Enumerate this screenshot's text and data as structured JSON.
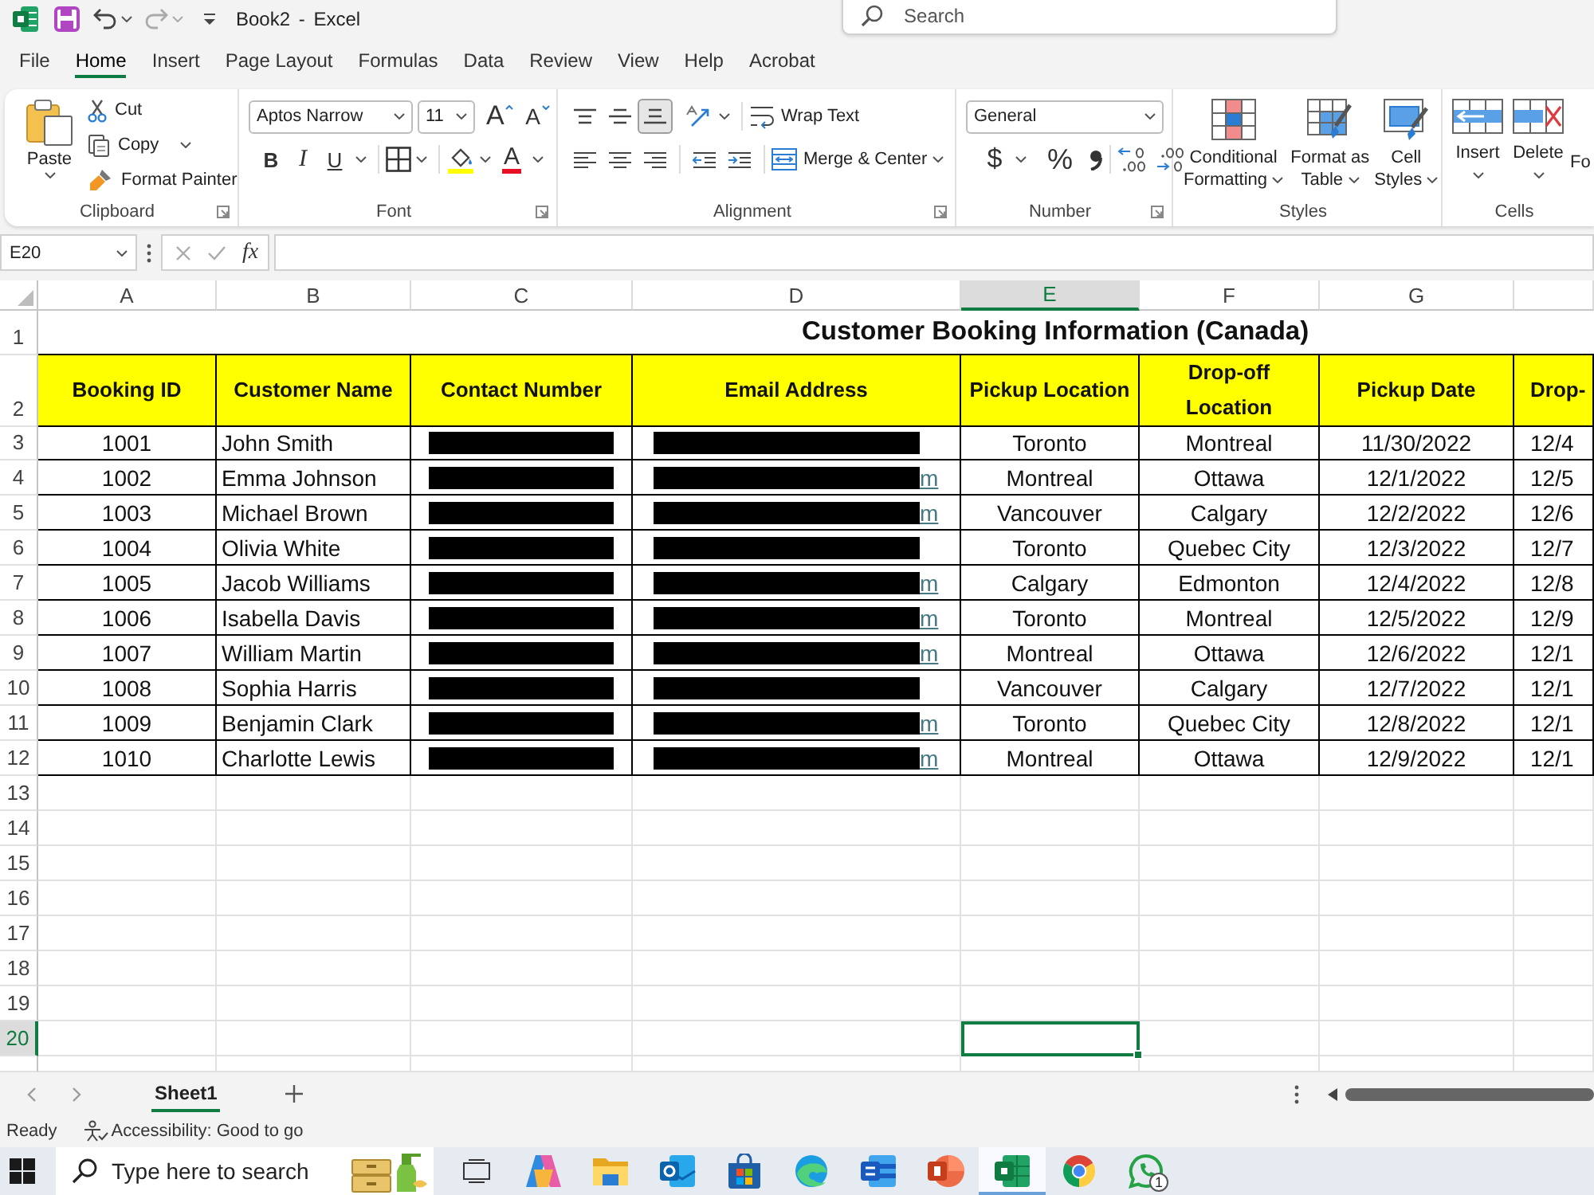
{
  "title_bar": {
    "title": "Book2 - Excel",
    "search": {
      "placeholder": "Search"
    }
  },
  "menu_tabs": [
    {
      "label": "File",
      "selected": false
    },
    {
      "label": "Home",
      "selected": true
    },
    {
      "label": "Insert",
      "selected": false
    },
    {
      "label": "Page Layout",
      "selected": false
    },
    {
      "label": "Formulas",
      "selected": false
    },
    {
      "label": "Data",
      "selected": false
    },
    {
      "label": "Review",
      "selected": false
    },
    {
      "label": "View",
      "selected": false
    },
    {
      "label": "Help",
      "selected": false
    },
    {
      "label": "Acrobat",
      "selected": false
    }
  ],
  "ribbon": [
    {
      "kind": "clipboard",
      "label": "Clipboard",
      "buttons": [
        "Paste",
        "Cut",
        "Copy",
        "Format Painter"
      ]
    },
    {
      "kind": "font",
      "label": "Font",
      "font_name": "Aptos Narrow",
      "font_size": "11",
      "buttons": [
        "A",
        "A",
        "B",
        "I",
        "U",
        "A"
      ]
    },
    {
      "kind": "alignment",
      "label": "Alignment",
      "vertical_align": [
        {
          "selected": false
        },
        {
          "selected": false
        },
        {
          "selected": true
        }
      ],
      "buttons": [
        "Wrap Text",
        "Merge & Center"
      ]
    },
    {
      "kind": "number",
      "label": "Number",
      "format": "General",
      "buttons": [
        "$",
        "%"
      ]
    },
    {
      "kind": "styles",
      "label": "Styles",
      "buttons": [
        "Conditional Formatting",
        "Format as Table",
        "Cell Styles"
      ]
    },
    {
      "kind": "cells",
      "label": "Cells",
      "buttons": [
        "Insert",
        "Delete",
        "Fo"
      ]
    }
  ],
  "formula_bar": {
    "name_box": "E20",
    "function_label": "fx"
  },
  "sheet": {
    "columns": [
      {
        "label": "A",
        "selected": false
      },
      {
        "label": "B",
        "selected": false
      },
      {
        "label": "C",
        "selected": false
      },
      {
        "label": "D",
        "selected": false
      },
      {
        "label": "E",
        "selected": true
      },
      {
        "label": "F",
        "selected": false
      },
      {
        "label": "G",
        "selected": false
      }
    ],
    "rows": [
      {
        "number": "1",
        "selected": false,
        "kind": "title",
        "text": "Customer Booking Information (Canada)"
      },
      {
        "number": "2",
        "selected": false,
        "kind": "header",
        "cells": [
          "Booking ID",
          "Customer Name",
          "Contact Number",
          "Email Address",
          "Pickup Location",
          "Drop-off Location",
          "Pickup Date",
          "Drop-"
        ]
      },
      {
        "number": "3",
        "selected": false,
        "kind": "data",
        "cells": [
          "1001",
          "John Smith",
          {
            "redacted": true
          },
          {
            "redacted": true
          },
          "Toronto",
          "Montreal",
          "11/30/2022",
          "12/4"
        ]
      },
      {
        "number": "4",
        "selected": false,
        "kind": "data",
        "cells": [
          "1002",
          "Emma Johnson",
          {
            "redacted": true
          },
          {
            "redacted": true,
            "tail": "m"
          },
          "Montreal",
          "Ottawa",
          "12/1/2022",
          "12/5"
        ]
      },
      {
        "number": "5",
        "selected": false,
        "kind": "data",
        "cells": [
          "1003",
          "Michael Brown",
          {
            "redacted": true
          },
          {
            "redacted": true,
            "tail": "m"
          },
          "Vancouver",
          "Calgary",
          "12/2/2022",
          "12/6"
        ]
      },
      {
        "number": "6",
        "selected": false,
        "kind": "data",
        "cells": [
          "1004",
          "Olivia White",
          {
            "redacted": true
          },
          {
            "redacted": true
          },
          "Toronto",
          "Quebec City",
          "12/3/2022",
          "12/7"
        ]
      },
      {
        "number": "7",
        "selected": false,
        "kind": "data",
        "cells": [
          "1005",
          "Jacob Williams",
          {
            "redacted": true
          },
          {
            "redacted": true,
            "tail": "m"
          },
          "Calgary",
          "Edmonton",
          "12/4/2022",
          "12/8"
        ]
      },
      {
        "number": "8",
        "selected": false,
        "kind": "data",
        "cells": [
          "1006",
          "Isabella Davis",
          {
            "redacted": true
          },
          {
            "redacted": true,
            "tail": "m"
          },
          "Toronto",
          "Montreal",
          "12/5/2022",
          "12/9"
        ]
      },
      {
        "number": "9",
        "selected": false,
        "kind": "data",
        "cells": [
          "1007",
          "William Martin",
          {
            "redacted": true
          },
          {
            "redacted": true,
            "tail": "m"
          },
          "Montreal",
          "Ottawa",
          "12/6/2022",
          "12/1"
        ]
      },
      {
        "number": "10",
        "selected": false,
        "kind": "data",
        "cells": [
          "1008",
          "Sophia Harris",
          {
            "redacted": true
          },
          {
            "redacted": true
          },
          "Vancouver",
          "Calgary",
          "12/7/2022",
          "12/1"
        ]
      },
      {
        "number": "11",
        "selected": false,
        "kind": "data",
        "cells": [
          "1009",
          "Benjamin Clark",
          {
            "redacted": true
          },
          {
            "redacted": true,
            "tail": "m"
          },
          "Toronto",
          "Quebec City",
          "12/8/2022",
          "12/1"
        ]
      },
      {
        "number": "12",
        "selected": false,
        "kind": "data",
        "cells": [
          "1010",
          "Charlotte Lewis",
          {
            "redacted": true
          },
          {
            "redacted": true,
            "tail": "m"
          },
          "Montreal",
          "Ottawa",
          "12/9/2022",
          "12/1"
        ]
      },
      {
        "number": "13",
        "selected": false,
        "kind": "empty"
      },
      {
        "number": "14",
        "selected": false,
        "kind": "empty"
      },
      {
        "number": "15",
        "selected": false,
        "kind": "empty"
      },
      {
        "number": "16",
        "selected": false,
        "kind": "empty"
      },
      {
        "number": "17",
        "selected": false,
        "kind": "empty"
      },
      {
        "number": "18",
        "selected": false,
        "kind": "empty"
      },
      {
        "number": "19",
        "selected": false,
        "kind": "empty"
      },
      {
        "number": "20",
        "selected": true,
        "kind": "empty"
      }
    ]
  },
  "sheet_tabs": [
    {
      "label": "Sheet1",
      "selected": true
    }
  ],
  "status_bar": {
    "status": "Ready",
    "accessibility": "Accessibility: Good to go"
  },
  "taskbar": {
    "search": {
      "placeholder": "Type here to search"
    },
    "apps": [
      {
        "selected": false
      },
      {
        "selected": false
      },
      {
        "selected": false
      },
      {
        "selected": false
      },
      {
        "selected": false
      },
      {
        "selected": false
      },
      {
        "selected": false
      },
      {
        "selected": false
      },
      {
        "selected": true
      },
      {
        "selected": false
      },
      {
        "selected": false,
        "badge": "1"
      }
    ]
  }
}
